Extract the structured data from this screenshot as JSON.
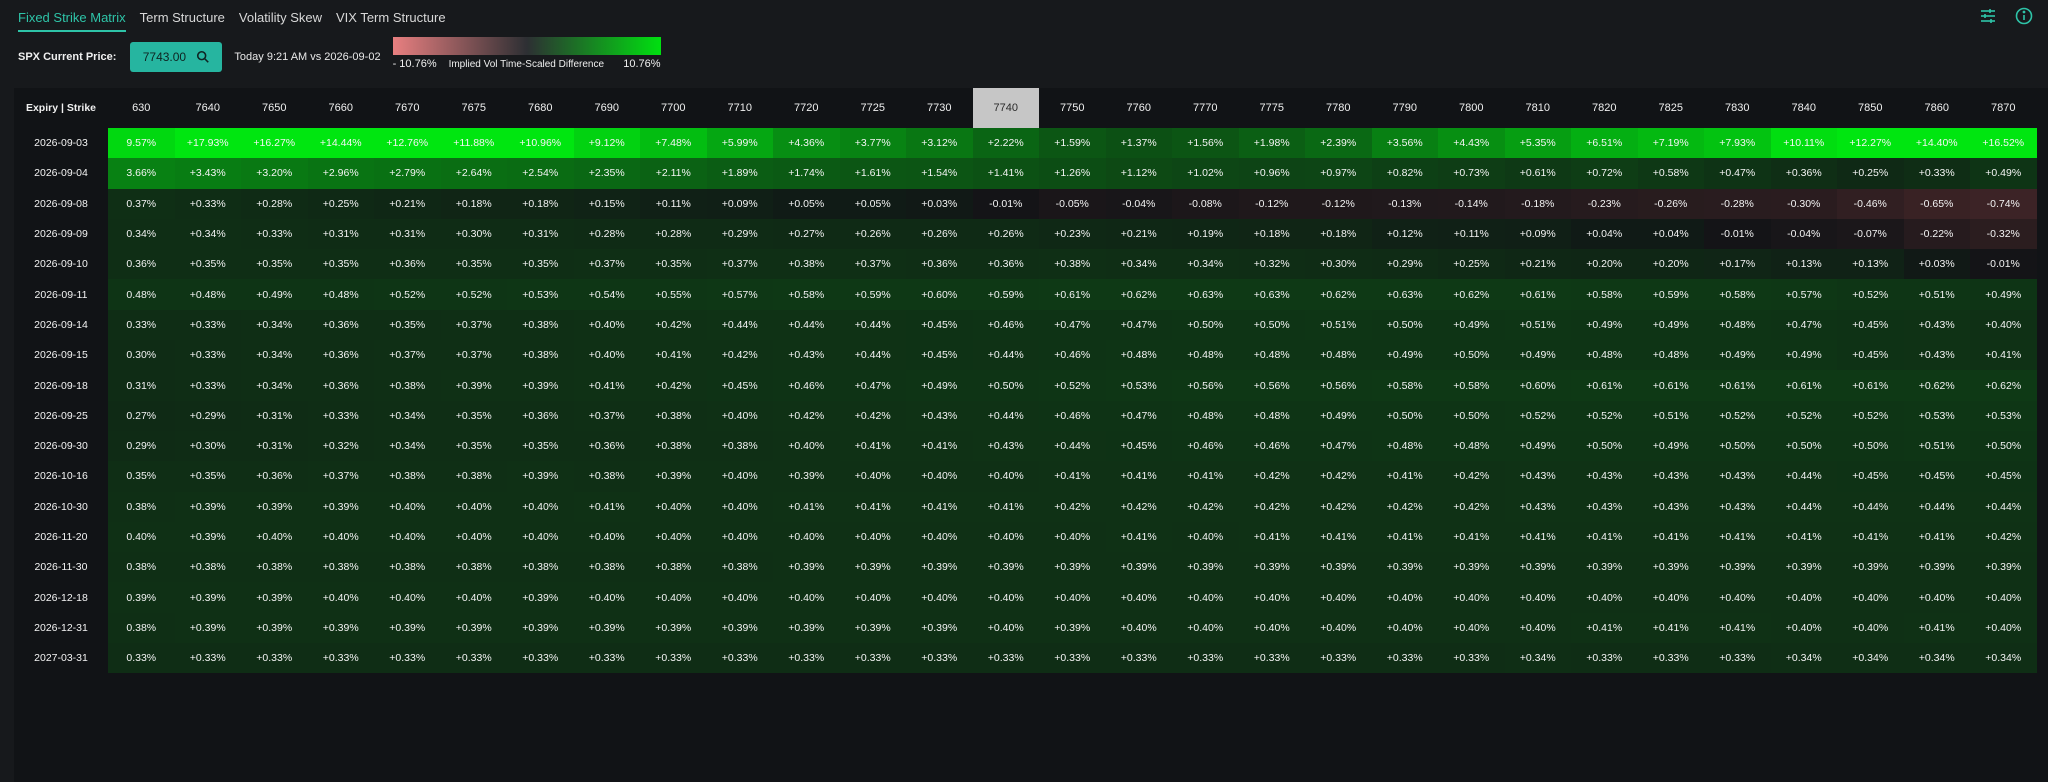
{
  "tabs": [
    {
      "label": "Fixed Strike Matrix",
      "active": true
    },
    {
      "label": "Term Structure",
      "active": false
    },
    {
      "label": "Volatility Skew",
      "active": false
    },
    {
      "label": "VIX Term Structure",
      "active": false
    }
  ],
  "icons": {
    "settings": "sliders-icon",
    "info": "info-icon"
  },
  "controls": {
    "spx_label": "SPX Current Price:",
    "price": "7743.00",
    "compare": "Today 9:21 AM vs 2026-09-02",
    "legend_min": "- 10.76%",
    "legend_label": "Implied Vol Time-Scaled Difference",
    "legend_max": "10.76%"
  },
  "colors": {
    "accent": "#2ec4a8",
    "positive_max": "#00e010",
    "negative_max": "#e87f80",
    "neutral": "#2d2f33"
  },
  "scale_max": 10.76,
  "matrix": {
    "corner_label": "Expiry | Strike",
    "highlight_strike": "7740",
    "strikes": [
      "630",
      "7640",
      "7650",
      "7660",
      "7670",
      "7675",
      "7680",
      "7690",
      "7700",
      "7710",
      "7720",
      "7725",
      "7730",
      "7740",
      "7750",
      "7760",
      "7770",
      "7775",
      "7780",
      "7790",
      "7800",
      "7810",
      "7820",
      "7825",
      "7830",
      "7840",
      "7850",
      "7860",
      "7870"
    ],
    "rows": [
      {
        "expiry": "2026-09-03",
        "cells": [
          "9.57%",
          "+17.93%",
          "+16.27%",
          "+14.44%",
          "+12.76%",
          "+11.88%",
          "+10.96%",
          "+9.12%",
          "+7.48%",
          "+5.99%",
          "+4.36%",
          "+3.77%",
          "+3.12%",
          "+2.22%",
          "+1.59%",
          "+1.37%",
          "+1.56%",
          "+1.98%",
          "+2.39%",
          "+3.56%",
          "+4.43%",
          "+5.35%",
          "+6.51%",
          "+7.19%",
          "+7.93%",
          "+10.11%",
          "+12.27%",
          "+14.40%",
          "+16.52%"
        ]
      },
      {
        "expiry": "2026-09-04",
        "cells": [
          "3.66%",
          "+3.43%",
          "+3.20%",
          "+2.96%",
          "+2.79%",
          "+2.64%",
          "+2.54%",
          "+2.35%",
          "+2.11%",
          "+1.89%",
          "+1.74%",
          "+1.61%",
          "+1.54%",
          "+1.41%",
          "+1.26%",
          "+1.12%",
          "+1.02%",
          "+0.96%",
          "+0.97%",
          "+0.82%",
          "+0.73%",
          "+0.61%",
          "+0.72%",
          "+0.58%",
          "+0.47%",
          "+0.36%",
          "+0.25%",
          "+0.33%",
          "+0.49%"
        ]
      },
      {
        "expiry": "2026-09-08",
        "cells": [
          "0.37%",
          "+0.33%",
          "+0.28%",
          "+0.25%",
          "+0.21%",
          "+0.18%",
          "+0.18%",
          "+0.15%",
          "+0.11%",
          "+0.09%",
          "+0.05%",
          "+0.05%",
          "+0.03%",
          "-0.01%",
          "-0.05%",
          "-0.04%",
          "-0.08%",
          "-0.12%",
          "-0.12%",
          "-0.13%",
          "-0.14%",
          "-0.18%",
          "-0.23%",
          "-0.26%",
          "-0.28%",
          "-0.30%",
          "-0.46%",
          "-0.65%",
          "-0.74%"
        ]
      },
      {
        "expiry": "2026-09-09",
        "cells": [
          "0.34%",
          "+0.34%",
          "+0.33%",
          "+0.31%",
          "+0.31%",
          "+0.30%",
          "+0.31%",
          "+0.28%",
          "+0.28%",
          "+0.29%",
          "+0.27%",
          "+0.26%",
          "+0.26%",
          "+0.26%",
          "+0.23%",
          "+0.21%",
          "+0.19%",
          "+0.18%",
          "+0.18%",
          "+0.12%",
          "+0.11%",
          "+0.09%",
          "+0.04%",
          "+0.04%",
          "-0.01%",
          "-0.04%",
          "-0.07%",
          "-0.22%",
          "-0.32%"
        ]
      },
      {
        "expiry": "2026-09-10",
        "cells": [
          "0.36%",
          "+0.35%",
          "+0.35%",
          "+0.35%",
          "+0.36%",
          "+0.35%",
          "+0.35%",
          "+0.37%",
          "+0.35%",
          "+0.37%",
          "+0.38%",
          "+0.37%",
          "+0.36%",
          "+0.36%",
          "+0.38%",
          "+0.34%",
          "+0.34%",
          "+0.32%",
          "+0.30%",
          "+0.29%",
          "+0.25%",
          "+0.21%",
          "+0.20%",
          "+0.20%",
          "+0.17%",
          "+0.13%",
          "+0.13%",
          "+0.03%",
          "-0.01%"
        ]
      },
      {
        "expiry": "2026-09-11",
        "cells": [
          "0.48%",
          "+0.48%",
          "+0.49%",
          "+0.48%",
          "+0.52%",
          "+0.52%",
          "+0.53%",
          "+0.54%",
          "+0.55%",
          "+0.57%",
          "+0.58%",
          "+0.59%",
          "+0.60%",
          "+0.59%",
          "+0.61%",
          "+0.62%",
          "+0.63%",
          "+0.63%",
          "+0.62%",
          "+0.63%",
          "+0.62%",
          "+0.61%",
          "+0.58%",
          "+0.59%",
          "+0.58%",
          "+0.57%",
          "+0.52%",
          "+0.51%",
          "+0.49%"
        ]
      },
      {
        "expiry": "2026-09-14",
        "cells": [
          "0.33%",
          "+0.33%",
          "+0.34%",
          "+0.36%",
          "+0.35%",
          "+0.37%",
          "+0.38%",
          "+0.40%",
          "+0.42%",
          "+0.44%",
          "+0.44%",
          "+0.44%",
          "+0.45%",
          "+0.46%",
          "+0.47%",
          "+0.47%",
          "+0.50%",
          "+0.50%",
          "+0.51%",
          "+0.50%",
          "+0.49%",
          "+0.51%",
          "+0.49%",
          "+0.49%",
          "+0.48%",
          "+0.47%",
          "+0.45%",
          "+0.43%",
          "+0.40%"
        ]
      },
      {
        "expiry": "2026-09-15",
        "cells": [
          "0.30%",
          "+0.33%",
          "+0.34%",
          "+0.36%",
          "+0.37%",
          "+0.37%",
          "+0.38%",
          "+0.40%",
          "+0.41%",
          "+0.42%",
          "+0.43%",
          "+0.44%",
          "+0.45%",
          "+0.44%",
          "+0.46%",
          "+0.48%",
          "+0.48%",
          "+0.48%",
          "+0.48%",
          "+0.49%",
          "+0.50%",
          "+0.49%",
          "+0.48%",
          "+0.48%",
          "+0.49%",
          "+0.49%",
          "+0.45%",
          "+0.43%",
          "+0.41%"
        ]
      },
      {
        "expiry": "2026-09-18",
        "cells": [
          "0.31%",
          "+0.33%",
          "+0.34%",
          "+0.36%",
          "+0.38%",
          "+0.39%",
          "+0.39%",
          "+0.41%",
          "+0.42%",
          "+0.45%",
          "+0.46%",
          "+0.47%",
          "+0.49%",
          "+0.50%",
          "+0.52%",
          "+0.53%",
          "+0.56%",
          "+0.56%",
          "+0.56%",
          "+0.58%",
          "+0.58%",
          "+0.60%",
          "+0.61%",
          "+0.61%",
          "+0.61%",
          "+0.61%",
          "+0.61%",
          "+0.62%",
          "+0.62%"
        ]
      },
      {
        "expiry": "2026-09-25",
        "cells": [
          "0.27%",
          "+0.29%",
          "+0.31%",
          "+0.33%",
          "+0.34%",
          "+0.35%",
          "+0.36%",
          "+0.37%",
          "+0.38%",
          "+0.40%",
          "+0.42%",
          "+0.42%",
          "+0.43%",
          "+0.44%",
          "+0.46%",
          "+0.47%",
          "+0.48%",
          "+0.48%",
          "+0.49%",
          "+0.50%",
          "+0.50%",
          "+0.52%",
          "+0.52%",
          "+0.51%",
          "+0.52%",
          "+0.52%",
          "+0.52%",
          "+0.53%",
          "+0.53%"
        ]
      },
      {
        "expiry": "2026-09-30",
        "cells": [
          "0.29%",
          "+0.30%",
          "+0.31%",
          "+0.32%",
          "+0.34%",
          "+0.35%",
          "+0.35%",
          "+0.36%",
          "+0.38%",
          "+0.38%",
          "+0.40%",
          "+0.41%",
          "+0.41%",
          "+0.43%",
          "+0.44%",
          "+0.45%",
          "+0.46%",
          "+0.46%",
          "+0.47%",
          "+0.48%",
          "+0.48%",
          "+0.49%",
          "+0.50%",
          "+0.49%",
          "+0.50%",
          "+0.50%",
          "+0.50%",
          "+0.51%",
          "+0.50%"
        ]
      },
      {
        "expiry": "2026-10-16",
        "cells": [
          "0.35%",
          "+0.35%",
          "+0.36%",
          "+0.37%",
          "+0.38%",
          "+0.38%",
          "+0.39%",
          "+0.38%",
          "+0.39%",
          "+0.40%",
          "+0.39%",
          "+0.40%",
          "+0.40%",
          "+0.40%",
          "+0.41%",
          "+0.41%",
          "+0.41%",
          "+0.42%",
          "+0.42%",
          "+0.41%",
          "+0.42%",
          "+0.43%",
          "+0.43%",
          "+0.43%",
          "+0.43%",
          "+0.44%",
          "+0.45%",
          "+0.45%",
          "+0.45%"
        ]
      },
      {
        "expiry": "2026-10-30",
        "cells": [
          "0.38%",
          "+0.39%",
          "+0.39%",
          "+0.39%",
          "+0.40%",
          "+0.40%",
          "+0.40%",
          "+0.41%",
          "+0.40%",
          "+0.40%",
          "+0.41%",
          "+0.41%",
          "+0.41%",
          "+0.41%",
          "+0.42%",
          "+0.42%",
          "+0.42%",
          "+0.42%",
          "+0.42%",
          "+0.42%",
          "+0.42%",
          "+0.43%",
          "+0.43%",
          "+0.43%",
          "+0.43%",
          "+0.44%",
          "+0.44%",
          "+0.44%",
          "+0.44%"
        ]
      },
      {
        "expiry": "2026-11-20",
        "cells": [
          "0.40%",
          "+0.39%",
          "+0.40%",
          "+0.40%",
          "+0.40%",
          "+0.40%",
          "+0.40%",
          "+0.40%",
          "+0.40%",
          "+0.40%",
          "+0.40%",
          "+0.40%",
          "+0.40%",
          "+0.40%",
          "+0.40%",
          "+0.41%",
          "+0.40%",
          "+0.41%",
          "+0.41%",
          "+0.41%",
          "+0.41%",
          "+0.41%",
          "+0.41%",
          "+0.41%",
          "+0.41%",
          "+0.41%",
          "+0.41%",
          "+0.41%",
          "+0.42%"
        ]
      },
      {
        "expiry": "2026-11-30",
        "cells": [
          "0.38%",
          "+0.38%",
          "+0.38%",
          "+0.38%",
          "+0.38%",
          "+0.38%",
          "+0.38%",
          "+0.38%",
          "+0.38%",
          "+0.38%",
          "+0.39%",
          "+0.39%",
          "+0.39%",
          "+0.39%",
          "+0.39%",
          "+0.39%",
          "+0.39%",
          "+0.39%",
          "+0.39%",
          "+0.39%",
          "+0.39%",
          "+0.39%",
          "+0.39%",
          "+0.39%",
          "+0.39%",
          "+0.39%",
          "+0.39%",
          "+0.39%",
          "+0.39%"
        ]
      },
      {
        "expiry": "2026-12-18",
        "cells": [
          "0.39%",
          "+0.39%",
          "+0.39%",
          "+0.40%",
          "+0.40%",
          "+0.40%",
          "+0.39%",
          "+0.40%",
          "+0.40%",
          "+0.40%",
          "+0.40%",
          "+0.40%",
          "+0.40%",
          "+0.40%",
          "+0.40%",
          "+0.40%",
          "+0.40%",
          "+0.40%",
          "+0.40%",
          "+0.40%",
          "+0.40%",
          "+0.40%",
          "+0.40%",
          "+0.40%",
          "+0.40%",
          "+0.40%",
          "+0.40%",
          "+0.40%",
          "+0.40%"
        ]
      },
      {
        "expiry": "2026-12-31",
        "cells": [
          "0.38%",
          "+0.39%",
          "+0.39%",
          "+0.39%",
          "+0.39%",
          "+0.39%",
          "+0.39%",
          "+0.39%",
          "+0.39%",
          "+0.39%",
          "+0.39%",
          "+0.39%",
          "+0.39%",
          "+0.40%",
          "+0.39%",
          "+0.40%",
          "+0.40%",
          "+0.40%",
          "+0.40%",
          "+0.40%",
          "+0.40%",
          "+0.40%",
          "+0.41%",
          "+0.41%",
          "+0.41%",
          "+0.40%",
          "+0.40%",
          "+0.41%",
          "+0.40%"
        ]
      },
      {
        "expiry": "2027-03-31",
        "cells": [
          "0.33%",
          "+0.33%",
          "+0.33%",
          "+0.33%",
          "+0.33%",
          "+0.33%",
          "+0.33%",
          "+0.33%",
          "+0.33%",
          "+0.33%",
          "+0.33%",
          "+0.33%",
          "+0.33%",
          "+0.33%",
          "+0.33%",
          "+0.33%",
          "+0.33%",
          "+0.33%",
          "+0.33%",
          "+0.33%",
          "+0.33%",
          "+0.34%",
          "+0.33%",
          "+0.33%",
          "+0.33%",
          "+0.34%",
          "+0.34%",
          "+0.34%",
          "+0.34%"
        ]
      }
    ]
  }
}
